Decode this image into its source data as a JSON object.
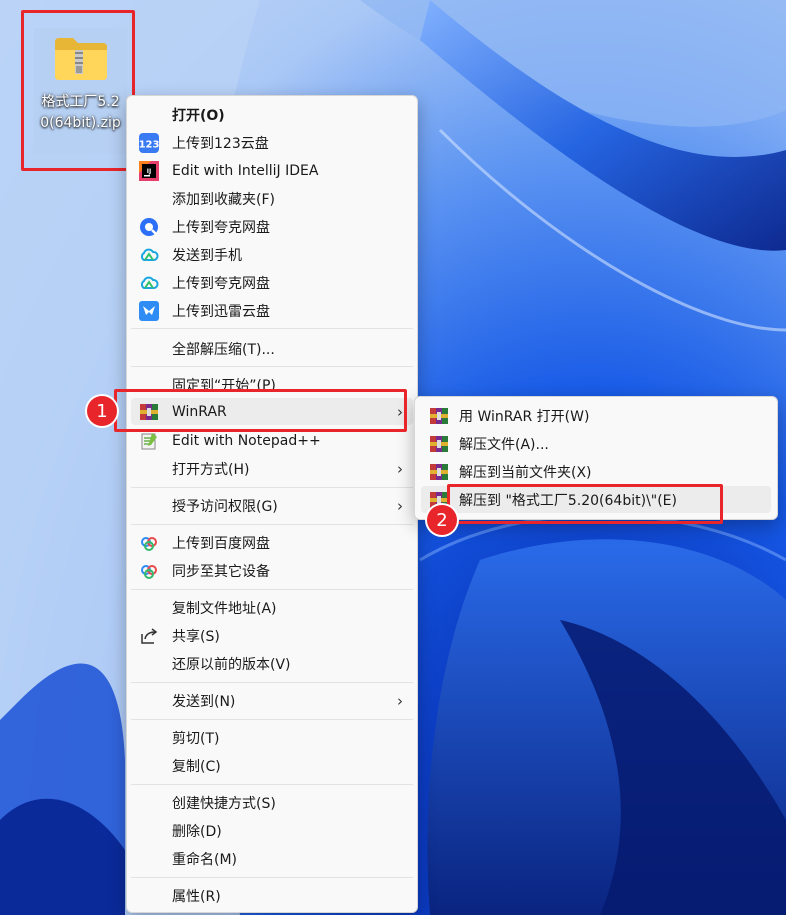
{
  "desktop": {
    "file_icon_label": "格式工厂5.20(64bit).zip"
  },
  "menu": {
    "items": [
      {
        "label": "打开(O)",
        "icon": "none"
      },
      {
        "label": "上传到123云盘",
        "icon": "123pan-icon"
      },
      {
        "label": "Edit with IntelliJ IDEA",
        "icon": "intellij-icon"
      },
      {
        "label": "添加到收藏夹(F)",
        "icon": "none"
      },
      {
        "label": "上传到夸克网盘",
        "icon": "quark-icon"
      },
      {
        "label": "发送到手机",
        "icon": "cloud-icon"
      },
      {
        "label": "上传到夸克网盘",
        "icon": "cloud-icon"
      },
      {
        "label": "上传到迅雷云盘",
        "icon": "xunlei-icon"
      },
      {
        "label": "全部解压缩(T)...",
        "icon": "none"
      },
      {
        "label": "固定到“开始”(P)",
        "icon": "none"
      },
      {
        "label": "WinRAR",
        "icon": "winrar-icon"
      },
      {
        "label": "Edit with Notepad++",
        "icon": "notepad-icon"
      },
      {
        "label": "打开方式(H)",
        "icon": "none"
      },
      {
        "label": "授予访问权限(G)",
        "icon": "none"
      },
      {
        "label": "上传到百度网盘",
        "icon": "baidu-icon"
      },
      {
        "label": "同步至其它设备",
        "icon": "baidu-icon"
      },
      {
        "label": "复制文件地址(A)",
        "icon": "none"
      },
      {
        "label": "共享(S)",
        "icon": "share-icon"
      },
      {
        "label": "还原以前的版本(V)",
        "icon": "none"
      },
      {
        "label": "发送到(N)",
        "icon": "none"
      },
      {
        "label": "剪切(T)",
        "icon": "none"
      },
      {
        "label": "复制(C)",
        "icon": "none"
      },
      {
        "label": "创建快捷方式(S)",
        "icon": "none"
      },
      {
        "label": "删除(D)",
        "icon": "none"
      },
      {
        "label": "重命名(M)",
        "icon": "none"
      },
      {
        "label": "属性(R)",
        "icon": "none"
      }
    ]
  },
  "submenu": {
    "items": [
      {
        "label": "用 WinRAR 打开(W)",
        "icon": "winrar-icon"
      },
      {
        "label": "解压文件(A)...",
        "icon": "winrar-icon"
      },
      {
        "label": "解压到当前文件夹(X)",
        "icon": "winrar-icon"
      },
      {
        "label": "解压到 \"格式工厂5.20(64bit)\\\"(E)",
        "icon": "winrar-icon"
      }
    ]
  },
  "annotations": {
    "step1": "1",
    "step2": "2",
    "color": "#e8252b"
  }
}
